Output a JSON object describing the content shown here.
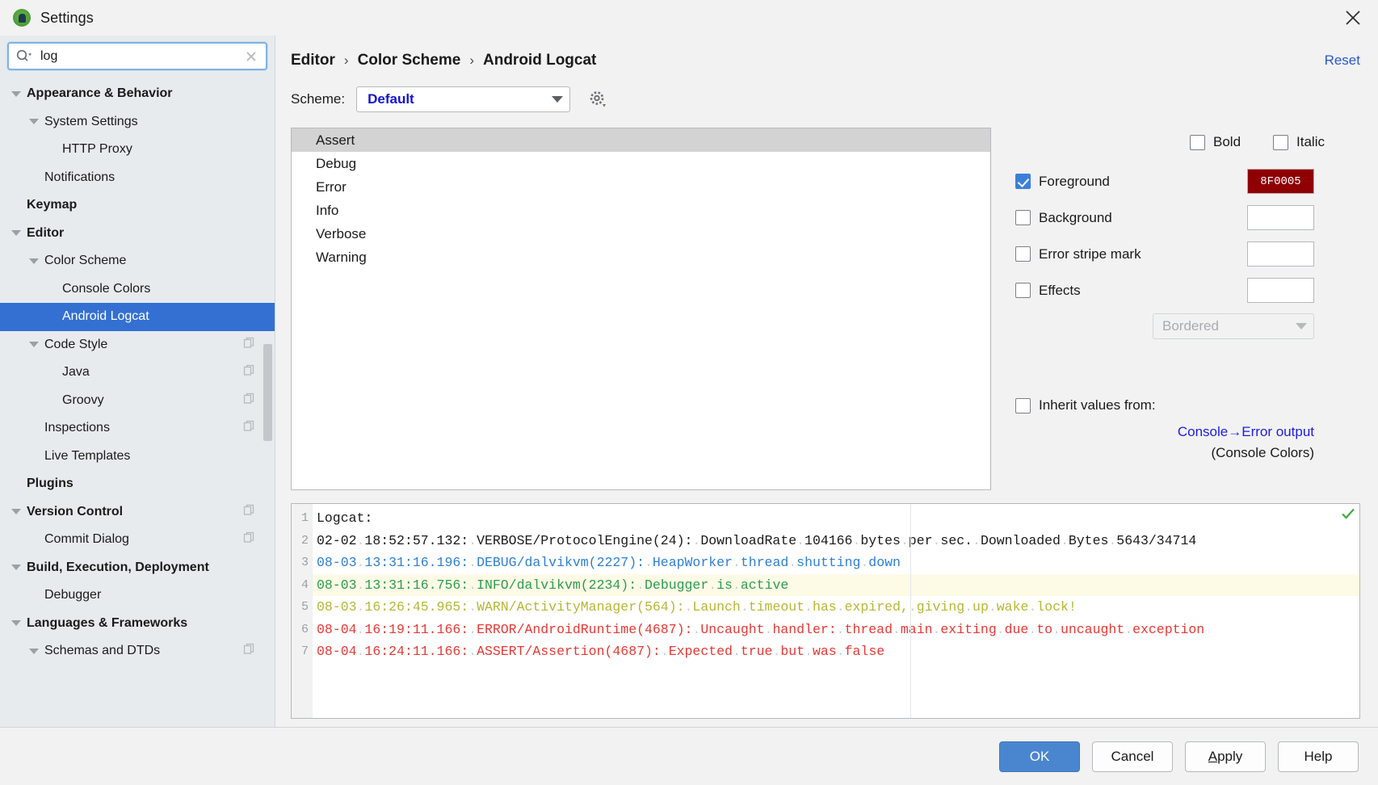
{
  "window": {
    "title": "Settings",
    "app_icon": "android-studio-icon",
    "close_icon": "close-icon"
  },
  "search": {
    "value": "log",
    "placeholder": "",
    "icon": "search-icon",
    "clear_icon": "clear-icon"
  },
  "sidebar": {
    "items": [
      {
        "label": "Appearance & Behavior",
        "level": 0,
        "bold": true,
        "twisty": true,
        "selected": false,
        "copy": false
      },
      {
        "label": "System Settings",
        "level": 1,
        "bold": false,
        "twisty": true,
        "selected": false,
        "copy": false
      },
      {
        "label": "HTTP Proxy",
        "level": 2,
        "bold": false,
        "twisty": false,
        "selected": false,
        "copy": false
      },
      {
        "label": "Notifications",
        "level": 1,
        "bold": false,
        "twisty": false,
        "selected": false,
        "copy": false
      },
      {
        "label": "Keymap",
        "level": 0,
        "bold": true,
        "twisty": false,
        "selected": false,
        "copy": false
      },
      {
        "label": "Editor",
        "level": 0,
        "bold": true,
        "twisty": true,
        "selected": false,
        "copy": false
      },
      {
        "label": "Color Scheme",
        "level": 1,
        "bold": false,
        "twisty": true,
        "selected": false,
        "copy": false
      },
      {
        "label": "Console Colors",
        "level": 2,
        "bold": false,
        "twisty": false,
        "selected": false,
        "copy": false
      },
      {
        "label": "Android Logcat",
        "level": 2,
        "bold": false,
        "twisty": false,
        "selected": true,
        "copy": false
      },
      {
        "label": "Code Style",
        "level": 1,
        "bold": false,
        "twisty": true,
        "selected": false,
        "copy": true
      },
      {
        "label": "Java",
        "level": 2,
        "bold": false,
        "twisty": false,
        "selected": false,
        "copy": true
      },
      {
        "label": "Groovy",
        "level": 2,
        "bold": false,
        "twisty": false,
        "selected": false,
        "copy": true
      },
      {
        "label": "Inspections",
        "level": 1,
        "bold": false,
        "twisty": false,
        "selected": false,
        "copy": true
      },
      {
        "label": "Live Templates",
        "level": 1,
        "bold": false,
        "twisty": false,
        "selected": false,
        "copy": false
      },
      {
        "label": "Plugins",
        "level": 0,
        "bold": true,
        "twisty": false,
        "selected": false,
        "copy": false
      },
      {
        "label": "Version Control",
        "level": 0,
        "bold": true,
        "twisty": true,
        "selected": false,
        "copy": true
      },
      {
        "label": "Commit Dialog",
        "level": 1,
        "bold": false,
        "twisty": false,
        "selected": false,
        "copy": true
      },
      {
        "label": "Build, Execution, Deployment",
        "level": 0,
        "bold": true,
        "twisty": true,
        "selected": false,
        "copy": false
      },
      {
        "label": "Debugger",
        "level": 1,
        "bold": false,
        "twisty": false,
        "selected": false,
        "copy": false
      },
      {
        "label": "Languages & Frameworks",
        "level": 0,
        "bold": true,
        "twisty": true,
        "selected": false,
        "copy": false
      },
      {
        "label": "Schemas and DTDs",
        "level": 1,
        "bold": false,
        "twisty": true,
        "selected": false,
        "copy": true
      }
    ]
  },
  "breadcrumb": {
    "part1": "Editor",
    "sep1": "›",
    "part2": "Color Scheme",
    "sep2": "›",
    "part3": "Android Logcat",
    "reset_label": "Reset"
  },
  "scheme": {
    "label": "Scheme:",
    "value": "Default",
    "gear_icon": "gear-icon",
    "dropdown_icon": "chevron-down-icon"
  },
  "color_list": {
    "items": [
      "Assert",
      "Debug",
      "Error",
      "Info",
      "Verbose",
      "Warning"
    ],
    "selected": "Assert"
  },
  "attributes": {
    "bold": {
      "label": "Bold",
      "checked": false
    },
    "italic": {
      "label": "Italic",
      "checked": false
    },
    "foreground": {
      "label": "Foreground",
      "checked": true,
      "color_hex": "8F0005",
      "swatch_color": "#8F0005"
    },
    "background": {
      "label": "Background",
      "checked": false,
      "color_hex": ""
    },
    "error_stripe": {
      "label": "Error stripe mark",
      "checked": false,
      "color_hex": ""
    },
    "effects": {
      "label": "Effects",
      "checked": false,
      "color_hex": ""
    },
    "effect_type": {
      "value": "Bordered",
      "enabled": false
    },
    "inherit": {
      "label": "Inherit values from:",
      "checked": false,
      "link": "Console→Error output",
      "sublabel": "(Console Colors)"
    }
  },
  "preview": {
    "check_icon": "green-check-icon",
    "lines": [
      {
        "num": "1",
        "highlight": false,
        "color": "#1a1a1a",
        "segments": [
          {
            "t": "Logcat:",
            "ws": false
          }
        ]
      },
      {
        "num": "2",
        "highlight": false,
        "color": "#1a1a1a",
        "segments": [
          {
            "t": "02-02",
            "ws": false
          },
          {
            "t": ".",
            "ws": true
          },
          {
            "t": "18:52:57.132:",
            "ws": false
          },
          {
            "t": ".",
            "ws": true
          },
          {
            "t": "VERBOSE/ProtocolEngine(24):",
            "ws": false
          },
          {
            "t": ".",
            "ws": true
          },
          {
            "t": "DownloadRate",
            "ws": false
          },
          {
            "t": ".",
            "ws": true
          },
          {
            "t": "104166",
            "ws": false
          },
          {
            "t": ".",
            "ws": true
          },
          {
            "t": "bytes",
            "ws": false
          },
          {
            "t": ".",
            "ws": true
          },
          {
            "t": "per",
            "ws": false
          },
          {
            "t": ".",
            "ws": true
          },
          {
            "t": "sec.",
            "ws": false
          },
          {
            "t": ".",
            "ws": true
          },
          {
            "t": "Downloaded",
            "ws": false
          },
          {
            "t": ".",
            "ws": true
          },
          {
            "t": "Bytes",
            "ws": false
          },
          {
            "t": ".",
            "ws": true
          },
          {
            "t": "5643/34714",
            "ws": false
          }
        ]
      },
      {
        "num": "3",
        "highlight": false,
        "color": "#2f7fd1",
        "segments": [
          {
            "t": "08-03",
            "ws": false
          },
          {
            "t": ".",
            "ws": true
          },
          {
            "t": "13:31:16.196:",
            "ws": false
          },
          {
            "t": ".",
            "ws": true
          },
          {
            "t": "DEBUG/dalvikvm(2227):",
            "ws": false
          },
          {
            "t": ".",
            "ws": true
          },
          {
            "t": "HeapWorker",
            "ws": false
          },
          {
            "t": ".",
            "ws": true
          },
          {
            "t": "thread",
            "ws": false
          },
          {
            "t": ".",
            "ws": true
          },
          {
            "t": "shutting",
            "ws": false
          },
          {
            "t": ".",
            "ws": true
          },
          {
            "t": "down",
            "ws": false
          }
        ]
      },
      {
        "num": "4",
        "highlight": true,
        "color": "#2e9b4e",
        "segments": [
          {
            "t": "08-03",
            "ws": false
          },
          {
            "t": ".",
            "ws": true
          },
          {
            "t": "13:31:16.756:",
            "ws": false
          },
          {
            "t": ".",
            "ws": true
          },
          {
            "t": "INFO/dalvikvm(2234):",
            "ws": false
          },
          {
            "t": ".",
            "ws": true
          },
          {
            "t": "Debugger",
            "ws": false
          },
          {
            "t": ".",
            "ws": true
          },
          {
            "t": "is",
            "ws": false
          },
          {
            "t": ".",
            "ws": true
          },
          {
            "t": "active",
            "ws": false
          }
        ]
      },
      {
        "num": "5",
        "highlight": false,
        "color": "#b5b634",
        "segments": [
          {
            "t": "08-03",
            "ws": false
          },
          {
            "t": ".",
            "ws": true
          },
          {
            "t": "16:26:45.965:",
            "ws": false
          },
          {
            "t": ".",
            "ws": true
          },
          {
            "t": "WARN/ActivityManager(564):",
            "ws": false
          },
          {
            "t": ".",
            "ws": true
          },
          {
            "t": "Launch",
            "ws": false
          },
          {
            "t": ".",
            "ws": true
          },
          {
            "t": "timeout",
            "ws": false
          },
          {
            "t": ".",
            "ws": true
          },
          {
            "t": "has",
            "ws": false
          },
          {
            "t": ".",
            "ws": true
          },
          {
            "t": "expired,",
            "ws": false
          },
          {
            "t": ".",
            "ws": true
          },
          {
            "t": "giving",
            "ws": false
          },
          {
            "t": ".",
            "ws": true
          },
          {
            "t": "up",
            "ws": false
          },
          {
            "t": ".",
            "ws": true
          },
          {
            "t": "wake",
            "ws": false
          },
          {
            "t": ".",
            "ws": true
          },
          {
            "t": "lock!",
            "ws": false
          }
        ]
      },
      {
        "num": "6",
        "highlight": false,
        "color": "#e53935",
        "segments": [
          {
            "t": "08-04",
            "ws": false
          },
          {
            "t": ".",
            "ws": true
          },
          {
            "t": "16:19:11.166:",
            "ws": false
          },
          {
            "t": ".",
            "ws": true
          },
          {
            "t": "ERROR/AndroidRuntime(4687):",
            "ws": false
          },
          {
            "t": ".",
            "ws": true
          },
          {
            "t": "Uncaught",
            "ws": false
          },
          {
            "t": ".",
            "ws": true
          },
          {
            "t": "handler:",
            "ws": false
          },
          {
            "t": ".",
            "ws": true
          },
          {
            "t": "thread",
            "ws": false
          },
          {
            "t": ".",
            "ws": true
          },
          {
            "t": "main",
            "ws": false
          },
          {
            "t": ".",
            "ws": true
          },
          {
            "t": "exiting",
            "ws": false
          },
          {
            "t": ".",
            "ws": true
          },
          {
            "t": "due",
            "ws": false
          },
          {
            "t": ".",
            "ws": true
          },
          {
            "t": "to",
            "ws": false
          },
          {
            "t": ".",
            "ws": true
          },
          {
            "t": "uncaught",
            "ws": false
          },
          {
            "t": ".",
            "ws": true
          },
          {
            "t": "exception",
            "ws": false
          }
        ]
      },
      {
        "num": "7",
        "highlight": false,
        "color": "#e53935",
        "segments": [
          {
            "t": "08-04",
            "ws": false
          },
          {
            "t": ".",
            "ws": true
          },
          {
            "t": "16:24:11.166:",
            "ws": false
          },
          {
            "t": ".",
            "ws": true
          },
          {
            "t": "ASSERT/Assertion(4687):",
            "ws": false
          },
          {
            "t": ".",
            "ws": true
          },
          {
            "t": "Expected",
            "ws": false
          },
          {
            "t": ".",
            "ws": true
          },
          {
            "t": "true",
            "ws": false
          },
          {
            "t": ".",
            "ws": true
          },
          {
            "t": "but",
            "ws": false
          },
          {
            "t": ".",
            "ws": true
          },
          {
            "t": "was",
            "ws": false
          },
          {
            "t": ".",
            "ws": true
          },
          {
            "t": "false",
            "ws": false
          }
        ]
      }
    ]
  },
  "footer": {
    "ok": "OK",
    "cancel": "Cancel",
    "apply_prefix": "A",
    "apply_rest": "pply",
    "help": "Help"
  }
}
